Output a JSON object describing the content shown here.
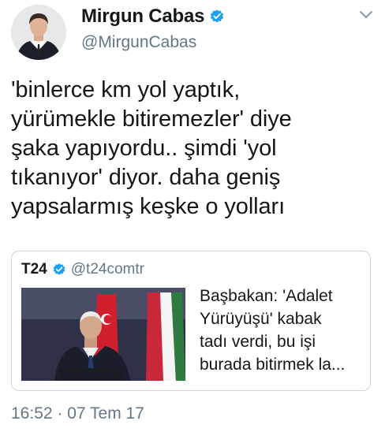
{
  "author": {
    "display_name": "Mirgun Cabas",
    "handle": "@MirgunCabas",
    "verified": true
  },
  "tweet": {
    "text": "'binlerce km yol yaptık,\nyürümekle bitiremezler' diye\nşaka yapıyordu.. şimdi 'yol\ntıkanıyor' diyor. daha geniş\nyapsalarmış keşke o yolları",
    "timestamp": "16:52 · 07 Tem 17"
  },
  "quoted": {
    "display_name": "T24",
    "handle": "@t24comtr",
    "verified": true,
    "text": "Başbakan: 'Adalet\nYürüyüşü' kabak\ntadı verdi, bu işi\nburada bitirmek la..."
  },
  "icons": {
    "menu": "chevron-down-icon",
    "verified": "verified-badge-icon"
  },
  "colors": {
    "verified_blue": "#1da1f2",
    "secondary_text": "#657786",
    "border": "#ccd6dd"
  }
}
